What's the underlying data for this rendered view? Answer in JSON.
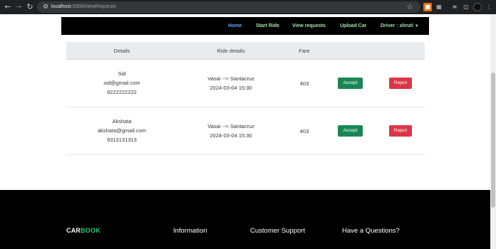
{
  "browser": {
    "url_host": "localhost",
    "url_path": ":5000/viewRequests"
  },
  "nav": {
    "items": [
      "Home",
      "Start Ride",
      "View requests",
      "Upload Car",
      "Driver : shruti"
    ],
    "active_color": "#5aa7ff",
    "item_color": "#a3e4a9"
  },
  "table": {
    "headers": [
      "Details",
      "Ride details",
      "Fare"
    ],
    "rows": [
      {
        "name": "Sid",
        "email": "sid@gmail.com",
        "phone": "9222222222",
        "route": "Vasai --> Santacruz",
        "datetime": "2024-03-04 15:30",
        "fare": "403",
        "accept": "Accept",
        "reject": "Reject"
      },
      {
        "name": "Akshata",
        "email": "akshata@gmail.com",
        "phone": "9313131313",
        "route": "Vasai --> Santacruz",
        "datetime": "2024-03-04 15:30",
        "fare": "403",
        "accept": "Accept",
        "reject": "Reject"
      }
    ]
  },
  "footer": {
    "brand_part1": "CAR",
    "brand_part2": "BOOK",
    "headings": [
      "Information",
      "Customer Support",
      "Have a Questions?"
    ],
    "brand_accent": "#1fce6f"
  },
  "colors": {
    "accept": "#198754",
    "reject": "#dc3545"
  }
}
